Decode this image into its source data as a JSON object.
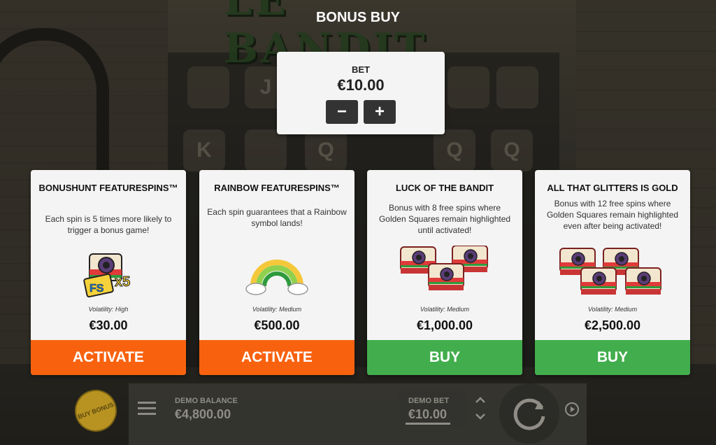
{
  "game": {
    "logo_text": "LE BANDIT",
    "reel_symbols": [
      "J",
      "K",
      "Q",
      "Q",
      "Q"
    ]
  },
  "dialog": {
    "title": "BONUS BUY"
  },
  "bet": {
    "label": "BET",
    "value": "€10.00",
    "decrease_label": "−",
    "increase_label": "+"
  },
  "cards": [
    {
      "title": "BONUSHUNT FEATURESPINS™",
      "description": "Each spin is 5 times more likely to trigger a bonus game!",
      "image_icon": "camera-fs-x5-icon",
      "image_text_fs": "FS",
      "image_text_mult": "x5",
      "volatility": "Volatility: High",
      "price": "€30.00",
      "action": "ACTIVATE",
      "action_color": "#f8620f"
    },
    {
      "title": "RAINBOW FEATURESPINS™",
      "description": "Each spin guarantees that a Rainbow symbol lands!",
      "image_icon": "rainbow-icon",
      "volatility": "Volatility: Medium",
      "price": "€500.00",
      "action": "ACTIVATE",
      "action_color": "#f8620f"
    },
    {
      "title": "LUCK OF THE BANDIT",
      "description": "Bonus with 8 free spins where Golden Squares remain highlighted until activated!",
      "image_icon": "three-cameras-icon",
      "volatility": "Volatility: Medium",
      "price": "€1,000.00",
      "action": "BUY",
      "action_color": "#42ad4c"
    },
    {
      "title": "ALL THAT GLITTERS IS GOLD",
      "description": "Bonus with 12 free spins where Golden Squares remain highlighted even after being activated!",
      "image_icon": "four-cameras-icon",
      "volatility": "Volatility: Medium",
      "price": "€2,500.00",
      "action": "BUY",
      "action_color": "#42ad4c"
    }
  ],
  "bottom_bar": {
    "buy_bonus_label": "BUY BONUS",
    "demo_balance_label": "DEMO BALANCE",
    "demo_balance_value": "€4,800.00",
    "demo_bet_label": "DEMO BET",
    "demo_bet_value": "€10.00"
  }
}
